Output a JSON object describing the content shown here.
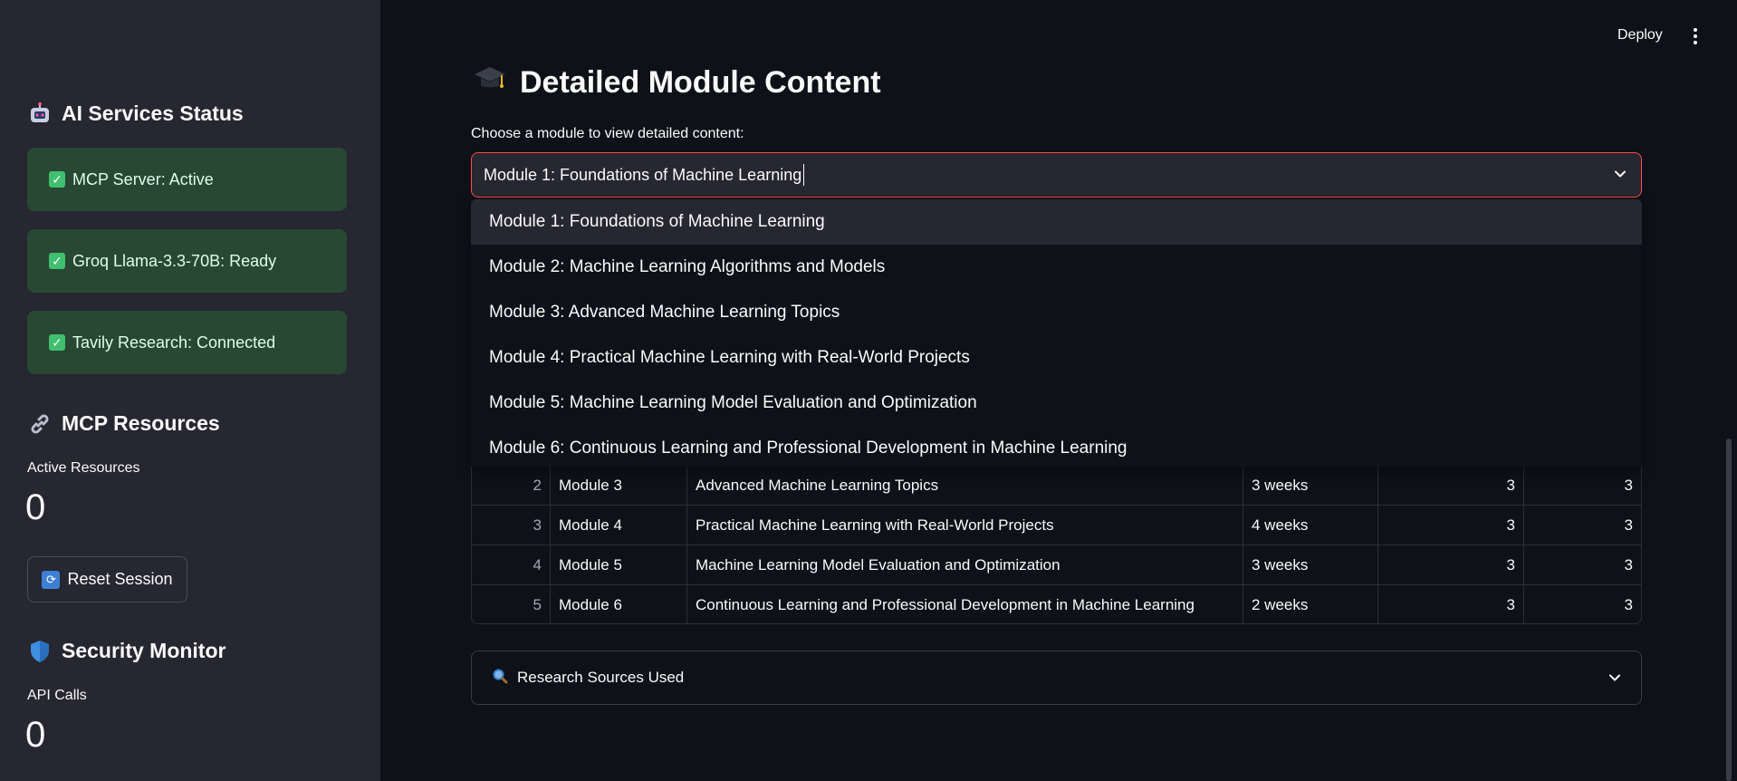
{
  "sidebar": {
    "services_heading": "AI Services Status",
    "services_icon": "robot-icon",
    "services": [
      {
        "label": "MCP Server: Active"
      },
      {
        "label": "Groq Llama-3.3-70B: Ready"
      },
      {
        "label": "Tavily Research: Connected"
      }
    ],
    "resources_heading": "MCP Resources",
    "resources_icon": "link-icon",
    "active_resources_label": "Active Resources",
    "active_resources_value": "0",
    "reset_label": "Reset Session",
    "security_heading": "Security Monitor",
    "security_icon": "shield-icon",
    "api_calls_label": "API Calls",
    "api_calls_value": "0"
  },
  "header": {
    "deploy_label": "Deploy"
  },
  "main": {
    "title": "Detailed Module Content",
    "title_icon": "graduation-cap-icon",
    "select_label": "Choose a module to view detailed content:",
    "select_value": "Module 1: Foundations of Machine Learning",
    "options": [
      "Module 1: Foundations of Machine Learning",
      "Module 2: Machine Learning Algorithms and Models",
      "Module 3: Advanced Machine Learning Topics",
      "Module 4: Practical Machine Learning with Real-World Projects",
      "Module 5: Machine Learning Model Evaluation and Optimization",
      "Module 6: Continuous Learning and Professional Development in Machine Learning"
    ],
    "table_rows": [
      {
        "idx": "2",
        "module": "Module 3",
        "title": "Advanced Machine Learning Topics",
        "duration": "3 weeks",
        "n1": "3",
        "n2": "3"
      },
      {
        "idx": "3",
        "module": "Module 4",
        "title": "Practical Machine Learning with Real-World Projects",
        "duration": "4 weeks",
        "n1": "3",
        "n2": "3"
      },
      {
        "idx": "4",
        "module": "Module 5",
        "title": "Machine Learning Model Evaluation and Optimization",
        "duration": "3 weeks",
        "n1": "3",
        "n2": "3"
      },
      {
        "idx": "5",
        "module": "Module 6",
        "title": "Continuous Learning and Professional Development in Machine Learning",
        "duration": "2 weeks",
        "n1": "3",
        "n2": "3"
      }
    ],
    "expander_label": "Research Sources Used",
    "expander_icon": "magnifier-icon"
  },
  "colors": {
    "accent": "#ff4b4b",
    "success_bg": "#284833",
    "sidebar_bg": "#262730",
    "main_bg": "#0e1117"
  }
}
